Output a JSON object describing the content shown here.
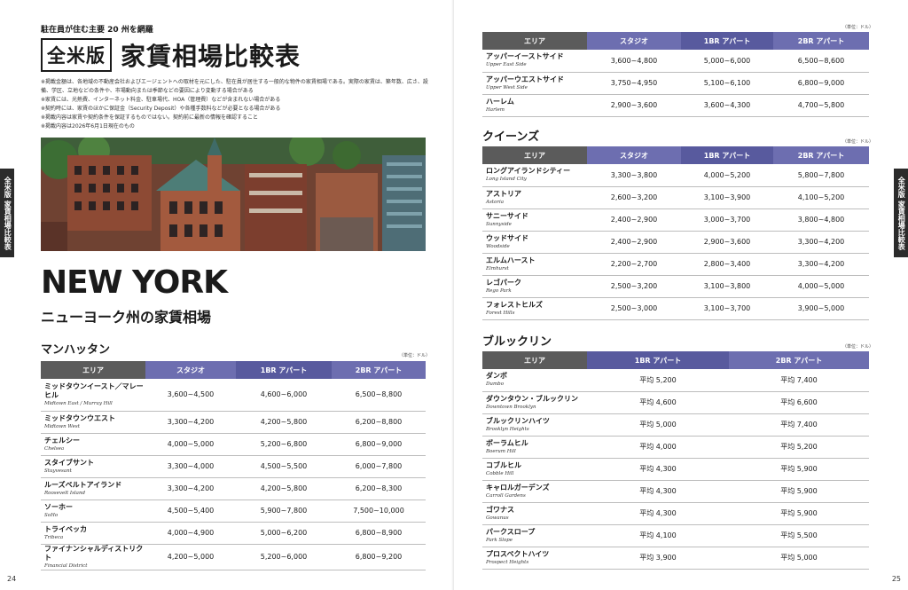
{
  "spread": {
    "side_tab_label": "全米版 家賃相場比較表",
    "left_page_number": "24",
    "right_page_number": "25"
  },
  "header": {
    "kicker": "駐在員が住む主要 20 州を網羅",
    "badge": "全米版",
    "title": "家賃相場比較表",
    "notes": [
      "※掲載金額は、各地域の不動産会社およびエージェントへの取材を元にした、駐在員が居住する一般的な物件の家賃相場である。実際の家賃は、築年数、広さ、設備、学区、立地などの条件や、市場動向または季節などの要因により変動する場合がある",
      "※家賃には、光熱費、インターネット料金、駐車場代、HOA（管理費）などが含まれない場合がある",
      "※契約時には、家賃のほかに保証金（Security Deposit）や各種手数料などが必要となる場合がある",
      "※掲載内容は家賃や契約条件を保証するものではない。契約前に最新の情報を確認すること",
      "※掲載内容は2026年6月1日現在のもの"
    ]
  },
  "state": {
    "name_en": "NEW YORK",
    "name_jp": "ニューヨーク州の家賃相場"
  },
  "unit_label": "（単位：ドル）",
  "columns": {
    "area": "エリア",
    "studio": "スタジオ",
    "br1": "1BR アパート",
    "br2": "2BR アパート"
  },
  "manhattan": {
    "title": "マンハッタン",
    "rows": [
      {
        "jp": "ミッドタウンイースト／マレーヒル",
        "en": "Midtown East / Murray Hill",
        "studio": "3,600~4,500",
        "br1": "4,600~6,000",
        "br2": "6,500~8,800"
      },
      {
        "jp": "ミッドタウンウエスト",
        "en": "Midtown West",
        "studio": "3,300~4,200",
        "br1": "4,200~5,800",
        "br2": "6,200~8,800"
      },
      {
        "jp": "チェルシー",
        "en": "Chelsea",
        "studio": "4,000~5,000",
        "br1": "5,200~6,800",
        "br2": "6,800~9,000"
      },
      {
        "jp": "スタイブサント",
        "en": "Stuyvesant",
        "studio": "3,300~4,000",
        "br1": "4,500~5,500",
        "br2": "6,000~7,800"
      },
      {
        "jp": "ルーズベルトアイランド",
        "en": "Roosevelt Island",
        "studio": "3,300~4,200",
        "br1": "4,200~5,800",
        "br2": "6,200~8,300"
      },
      {
        "jp": "ソーホー",
        "en": "SoHo",
        "studio": "4,500~5,400",
        "br1": "5,900~7,800",
        "br2": "7,500~10,000"
      },
      {
        "jp": "トライベッカ",
        "en": "Tribeca",
        "studio": "4,000~4,900",
        "br1": "5,000~6,200",
        "br2": "6,800~8,900"
      },
      {
        "jp": "ファイナンシャルディストリクト",
        "en": "Financial District",
        "studio": "4,200~5,000",
        "br1": "5,200~6,000",
        "br2": "6,800~9,200"
      }
    ]
  },
  "manhattan_cont": {
    "rows": [
      {
        "jp": "アッパーイーストサイド",
        "en": "Upper East Side",
        "studio": "3,600~4,800",
        "br1": "5,000~6,000",
        "br2": "6,500~8,600"
      },
      {
        "jp": "アッパーウエストサイド",
        "en": "Upper West Side",
        "studio": "3,750~4,950",
        "br1": "5,100~6,100",
        "br2": "6,800~9,000"
      },
      {
        "jp": "ハーレム",
        "en": "Harlem",
        "studio": "2,900~3,600",
        "br1": "3,600~4,300",
        "br2": "4,700~5,800"
      }
    ]
  },
  "queens": {
    "title": "クイーンズ",
    "rows": [
      {
        "jp": "ロングアイランドシティー",
        "en": "Long Island City",
        "studio": "3,300~3,800",
        "br1": "4,000~5,200",
        "br2": "5,800~7,800"
      },
      {
        "jp": "アストリア",
        "en": "Astoria",
        "studio": "2,600~3,200",
        "br1": "3,100~3,900",
        "br2": "4,100~5,200"
      },
      {
        "jp": "サニーサイド",
        "en": "Sunnyside",
        "studio": "2,400~2,900",
        "br1": "3,000~3,700",
        "br2": "3,800~4,800"
      },
      {
        "jp": "ウッドサイド",
        "en": "Woodside",
        "studio": "2,400~2,900",
        "br1": "2,900~3,600",
        "br2": "3,300~4,200"
      },
      {
        "jp": "エルムハースト",
        "en": "Elmhurst",
        "studio": "2,200~2,700",
        "br1": "2,800~3,400",
        "br2": "3,300~4,200"
      },
      {
        "jp": "レゴパーク",
        "en": "Rego Park",
        "studio": "2,500~3,200",
        "br1": "3,100~3,800",
        "br2": "4,000~5,000"
      },
      {
        "jp": "フォレストヒルズ",
        "en": "Forest Hills",
        "studio": "2,500~3,000",
        "br1": "3,100~3,700",
        "br2": "3,900~5,000"
      }
    ]
  },
  "brooklyn": {
    "title": "ブルックリン",
    "rows": [
      {
        "jp": "ダンボ",
        "en": "Dumbo",
        "br1": "平均 5,200",
        "br2": "平均 7,400"
      },
      {
        "jp": "ダウンタウン・ブルックリン",
        "en": "Downtown Brooklyn",
        "br1": "平均 4,600",
        "br2": "平均 6,600"
      },
      {
        "jp": "ブルックリンハイツ",
        "en": "Brooklyn Heights",
        "br1": "平均 5,000",
        "br2": "平均 7,400"
      },
      {
        "jp": "ボーラムヒル",
        "en": "Boerum Hill",
        "br1": "平均 4,000",
        "br2": "平均 5,200"
      },
      {
        "jp": "コブルヒル",
        "en": "Cobble Hill",
        "br1": "平均 4,300",
        "br2": "平均 5,900"
      },
      {
        "jp": "キャロルガーデンズ",
        "en": "Carroll Gardens",
        "br1": "平均 4,300",
        "br2": "平均 5,900"
      },
      {
        "jp": "ゴワナス",
        "en": "Gowanus",
        "br1": "平均 4,300",
        "br2": "平均 5,900"
      },
      {
        "jp": "パークスロープ",
        "en": "Park Slope",
        "br1": "平均 4,100",
        "br2": "平均 5,500"
      },
      {
        "jp": "プロスペクトハイツ",
        "en": "Prospect Heights",
        "br1": "平均 3,900",
        "br2": "平均 5,000"
      }
    ]
  }
}
